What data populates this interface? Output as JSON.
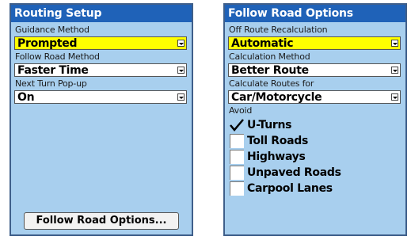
{
  "routing_setup": {
    "title": "Routing Setup",
    "guidance_method": {
      "label": "Guidance Method",
      "value": "Prompted"
    },
    "follow_road_method": {
      "label": "Follow Road Method",
      "value": "Faster Time"
    },
    "next_turn_popup": {
      "label": "Next Turn Pop-up",
      "value": "On"
    },
    "follow_road_options_button": "Follow Road Options..."
  },
  "follow_road_options": {
    "title": "Follow Road Options",
    "off_route_recalculation": {
      "label": "Off Route Recalculation",
      "value": "Automatic"
    },
    "calculation_method": {
      "label": "Calculation Method",
      "value": "Better Route"
    },
    "calculate_routes_for": {
      "label": "Calculate Routes for",
      "value": "Car/Motorcycle"
    },
    "avoid_label": "Avoid",
    "avoid": [
      {
        "label": "U-Turns",
        "checked": true
      },
      {
        "label": "Toll Roads",
        "checked": false
      },
      {
        "label": "Highways",
        "checked": false
      },
      {
        "label": "Unpaved Roads",
        "checked": false
      },
      {
        "label": "Carpool Lanes",
        "checked": false
      }
    ]
  },
  "colors": {
    "screen_bg": "#a8cfee",
    "titlebar_bg": "#1f62b8",
    "selected_field": "#ffff00"
  }
}
